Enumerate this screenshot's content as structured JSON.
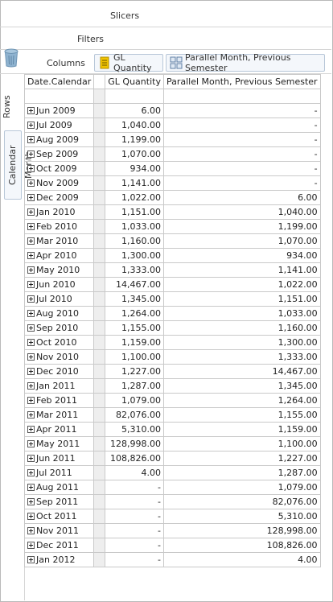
{
  "zones": {
    "slicers_label": "Slicers",
    "filters_label": "Filters",
    "columns_label": "Columns",
    "rows_label": "Rows"
  },
  "chips": {
    "rows_chip": "Calendar Month",
    "measure_chip": "GL Quantity",
    "calc_chip": "Parallel Month, Previous Semester"
  },
  "grid": {
    "headers": [
      "Date.Calendar",
      "GL Quantity",
      "Parallel Month, Previous Semester"
    ],
    "rows": [
      {
        "label": "Jun 2009",
        "gl": "6.00",
        "par": "-"
      },
      {
        "label": "Jul 2009",
        "gl": "1,040.00",
        "par": "-"
      },
      {
        "label": "Aug 2009",
        "gl": "1,199.00",
        "par": "-"
      },
      {
        "label": "Sep 2009",
        "gl": "1,070.00",
        "par": "-"
      },
      {
        "label": "Oct 2009",
        "gl": "934.00",
        "par": "-"
      },
      {
        "label": "Nov 2009",
        "gl": "1,141.00",
        "par": "-"
      },
      {
        "label": "Dec 2009",
        "gl": "1,022.00",
        "par": "6.00"
      },
      {
        "label": "Jan 2010",
        "gl": "1,151.00",
        "par": "1,040.00"
      },
      {
        "label": "Feb 2010",
        "gl": "1,033.00",
        "par": "1,199.00"
      },
      {
        "label": "Mar 2010",
        "gl": "1,160.00",
        "par": "1,070.00"
      },
      {
        "label": "Apr 2010",
        "gl": "1,300.00",
        "par": "934.00"
      },
      {
        "label": "May 2010",
        "gl": "1,333.00",
        "par": "1,141.00"
      },
      {
        "label": "Jun 2010",
        "gl": "14,467.00",
        "par": "1,022.00"
      },
      {
        "label": "Jul 2010",
        "gl": "1,345.00",
        "par": "1,151.00"
      },
      {
        "label": "Aug 2010",
        "gl": "1,264.00",
        "par": "1,033.00"
      },
      {
        "label": "Sep 2010",
        "gl": "1,155.00",
        "par": "1,160.00"
      },
      {
        "label": "Oct 2010",
        "gl": "1,159.00",
        "par": "1,300.00"
      },
      {
        "label": "Nov 2010",
        "gl": "1,100.00",
        "par": "1,333.00"
      },
      {
        "label": "Dec 2010",
        "gl": "1,227.00",
        "par": "14,467.00"
      },
      {
        "label": "Jan 2011",
        "gl": "1,287.00",
        "par": "1,345.00"
      },
      {
        "label": "Feb 2011",
        "gl": "1,079.00",
        "par": "1,264.00"
      },
      {
        "label": "Mar 2011",
        "gl": "82,076.00",
        "par": "1,155.00"
      },
      {
        "label": "Apr 2011",
        "gl": "5,310.00",
        "par": "1,159.00"
      },
      {
        "label": "May 2011",
        "gl": "128,998.00",
        "par": "1,100.00"
      },
      {
        "label": "Jun 2011",
        "gl": "108,826.00",
        "par": "1,227.00"
      },
      {
        "label": "Jul 2011",
        "gl": "4.00",
        "par": "1,287.00"
      },
      {
        "label": "Aug 2011",
        "gl": "-",
        "par": "1,079.00"
      },
      {
        "label": "Sep 2011",
        "gl": "-",
        "par": "82,076.00"
      },
      {
        "label": "Oct 2011",
        "gl": "-",
        "par": "5,310.00"
      },
      {
        "label": "Nov 2011",
        "gl": "-",
        "par": "128,998.00"
      },
      {
        "label": "Dec 2011",
        "gl": "-",
        "par": "108,826.00"
      },
      {
        "label": "Jan 2012",
        "gl": "-",
        "par": "4.00"
      }
    ]
  },
  "colors": {
    "border": "#c9c9c9",
    "chip_border": "#b8c7d8",
    "measure_icon": "#f2c400",
    "trash_icon": "#8fb3d0"
  },
  "icons": {
    "trash": "trash-icon",
    "measure": "measure-icon",
    "calc": "calculated-member-icon",
    "expand": "expand-plus-icon"
  }
}
